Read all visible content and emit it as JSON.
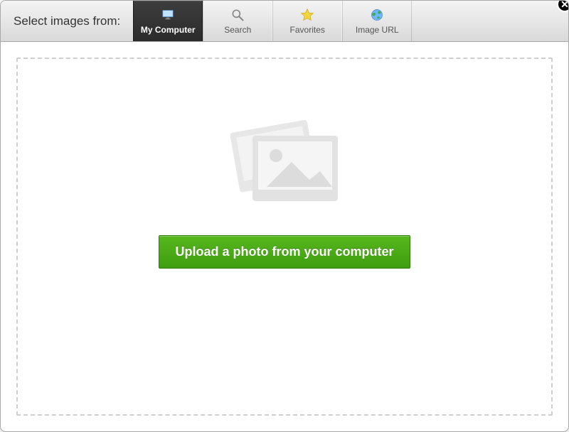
{
  "toolbar": {
    "prompt": "Select images from:",
    "tabs": [
      {
        "id": "my-computer",
        "label": "My Computer",
        "icon": "monitor-icon",
        "active": true
      },
      {
        "id": "search",
        "label": "Search",
        "icon": "magnifier-icon",
        "active": false
      },
      {
        "id": "favorites",
        "label": "Favorites",
        "icon": "star-icon",
        "active": false
      },
      {
        "id": "image-url",
        "label": "Image URL",
        "icon": "globe-icon",
        "active": false
      }
    ]
  },
  "upload": {
    "button_label": "Upload a photo from your computer"
  },
  "colors": {
    "accent_green": "#46a512",
    "toolbar_dark": "#2f2f2f"
  }
}
